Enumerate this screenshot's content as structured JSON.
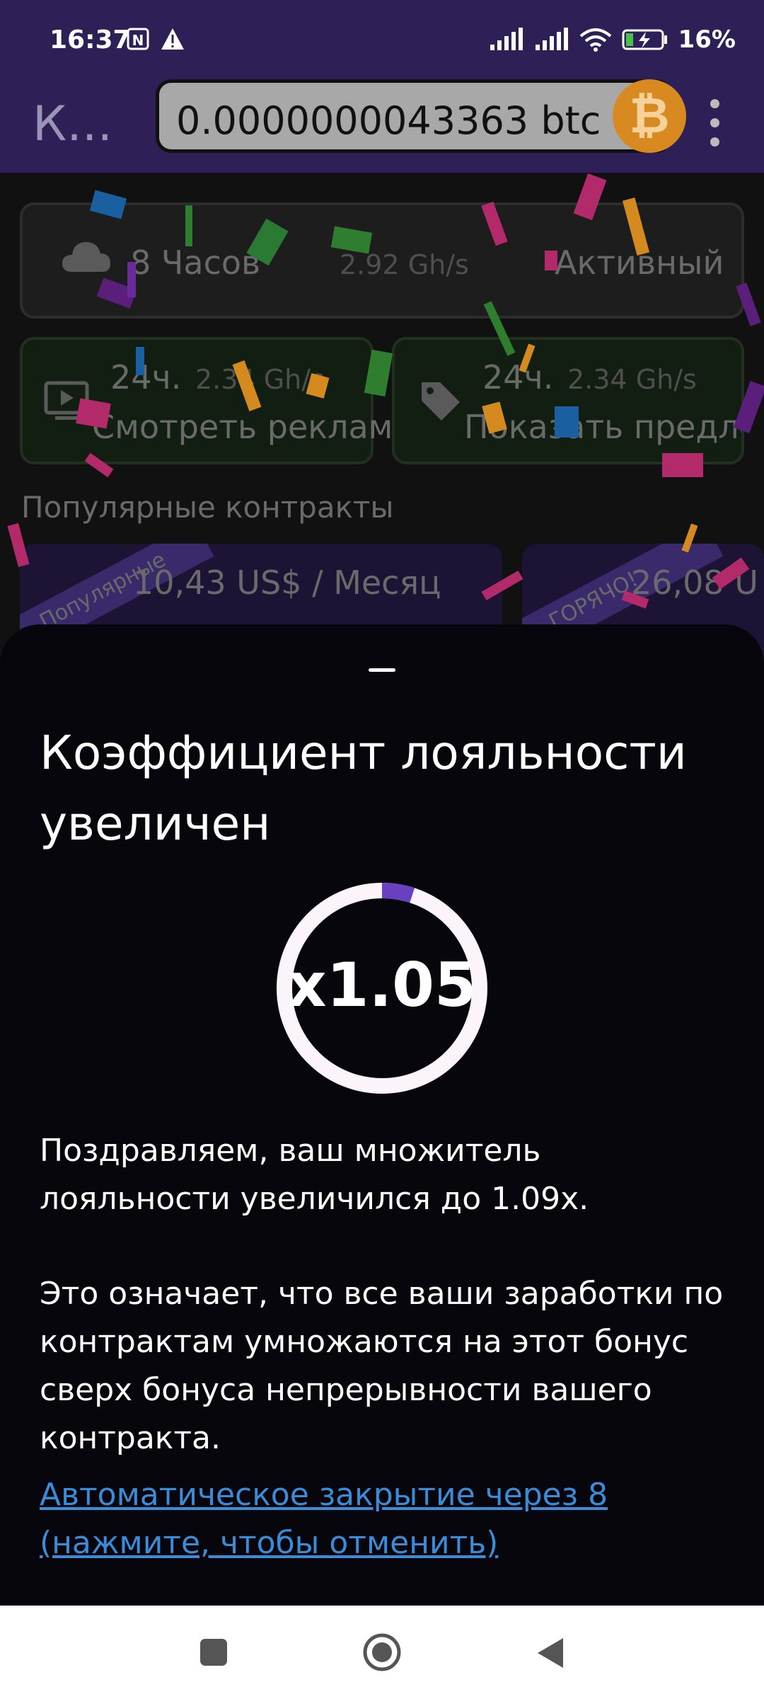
{
  "status_bar": {
    "time": "16:37",
    "left_icons": [
      "nfc-icon",
      "warning-icon"
    ],
    "right_icons": [
      "signal-icon",
      "signal-icon",
      "wifi-icon",
      "battery-charging-icon"
    ],
    "battery": "16%"
  },
  "app_bar": {
    "title": "К...",
    "balance": "0.0000000043363 btc",
    "coin_symbol": "₿",
    "menu_icon": "kebab-menu-icon"
  },
  "mining_card": {
    "duration": "8 Часов",
    "speed": "2.92 Gh/s",
    "state": "Активный"
  },
  "boost_cards": [
    {
      "period": "24ч.",
      "speed": "2.34 Gh/s",
      "label": "Смотреть рекламу",
      "icon": "video-ad-icon"
    },
    {
      "period": "24ч.",
      "speed": "2.34 Gh/s",
      "label": "Показать предло",
      "icon": "price-tag-icon"
    }
  ],
  "contracts": {
    "heading": "Популярные контракты",
    "items": [
      {
        "badge": "Популярные",
        "price": "10,43 US$ / Месяц"
      },
      {
        "badge": "ГОРЯЧО!",
        "price": "26,08 U"
      }
    ]
  },
  "sheet": {
    "title": "Коэффициент лояльности увеличен",
    "multiplier": "x1.05",
    "progress_fraction": 0.05,
    "paragraph1": "Поздравляем, ваш множитель лояльности увеличился до 1.09x.",
    "paragraph2": "Это означает, что все ваши заработки по контрактам умножаются на этот бонус сверх бонуса непрерывности вашего контракта.",
    "auto_close": "Автоматическое закрытие через 8 (нажмите, чтобы отменить)"
  },
  "nav": {
    "icons": [
      "recents-icon",
      "home-icon",
      "back-icon"
    ]
  },
  "colors": {
    "app_bar": "#2f1f57",
    "accent": "#6a3fc0",
    "link": "#3a8cd8",
    "coin": "#d88a20"
  }
}
